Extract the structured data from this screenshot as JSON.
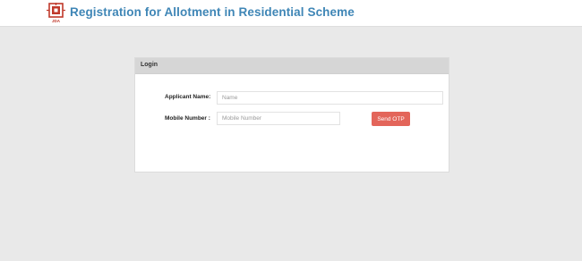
{
  "header": {
    "title": "Registration for Allotment in Residential Scheme",
    "logo_caption": "JDA",
    "title_color": "#3f86b6",
    "logo_color": "#c0392b"
  },
  "login": {
    "heading": "Login",
    "applicant_label": "Applicant Name:",
    "applicant_placeholder": "Name",
    "applicant_value": "",
    "mobile_label": "Mobile Number :",
    "mobile_placeholder": "Mobile Number",
    "mobile_value": "",
    "send_otp_label": "Send OTP",
    "button_color": "#e3655a"
  }
}
